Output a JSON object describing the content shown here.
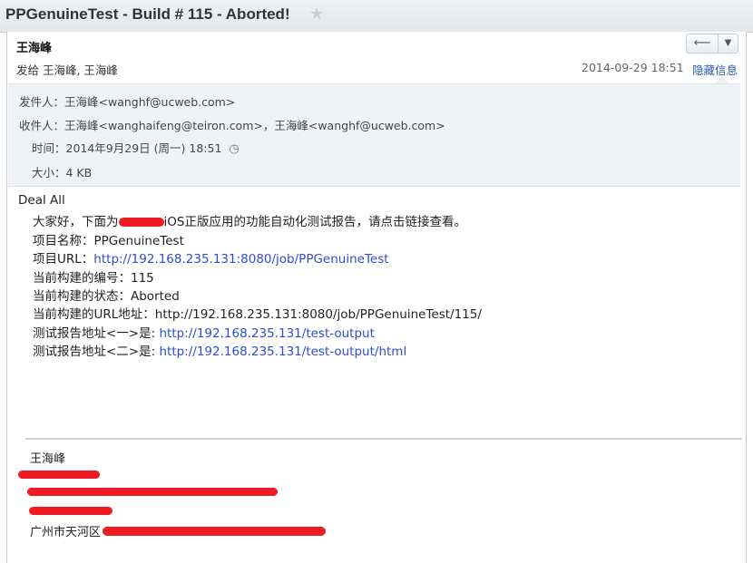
{
  "window": {
    "title": "PPGenuineTest - Build # 115 - Aborted!",
    "star_icon": "star-outline-icon"
  },
  "message": {
    "from_name": "王海峰",
    "send_to": "发给 王海峰, 王海峰",
    "date": "2014-09-29 18:51",
    "hide_info": "隐藏信息",
    "reply_icon": "reply-arrow-icon",
    "menu_icon": "chevron-down-icon"
  },
  "details": {
    "sender": "发件人：王海峰<wanghf@ucweb.com>",
    "recipients": "收件人：王海峰<wanghaifeng@teiron.com>，王海峰<wanghf@ucweb.com>",
    "time": "时间：2014年9月29日 (周一) 18:51",
    "size": "大小：4 KB",
    "clock_icon": "clock-icon"
  },
  "body": {
    "greeting": "Deal All",
    "intro_prefix": "大家好，下面为",
    "intro_suffix": "iOS正版应用的功能自动化测试报告，请点击链接查看。",
    "project_name": "项目名称：PPGenuineTest",
    "project_url_label": "项目URL：",
    "project_url": "http://192.168.235.131:8080/job/PPGenuineTest",
    "build_number": "当前构建的编号：115",
    "build_status": "当前构建的状态：Aborted",
    "build_url": "当前构建的URL地址：http://192.168.235.131:8080/job/PPGenuineTest/115/",
    "report1_label": "测试报告地址<一>是: ",
    "report1_url": "http://192.168.235.131/test-output",
    "report2_label": "测试报告地址<二>是: ",
    "report2_url": "http://192.168.235.131/test-output/html"
  },
  "signature": {
    "name": "王海峰",
    "address_prefix": "广州市天河区"
  },
  "colors": {
    "link": "#2a4fd0",
    "redaction": "#ee1b22",
    "details_bg": "#f0f3f5"
  }
}
